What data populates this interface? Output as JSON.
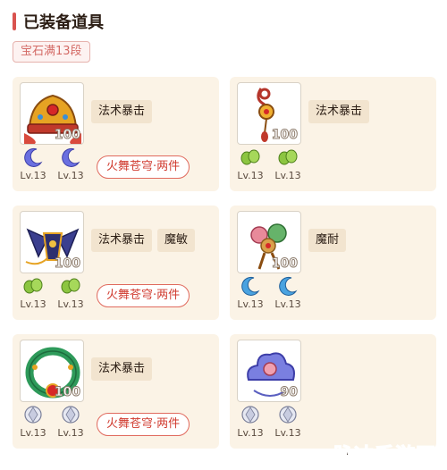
{
  "header": {
    "title": "已装备道具"
  },
  "tag": {
    "label": "宝石满13段"
  },
  "cards": [
    {
      "level": "100",
      "attrs": [
        "法术暴击"
      ],
      "gems": [
        {
          "icon": "moon-gem-icon",
          "level": "Lv.13"
        },
        {
          "icon": "moon-gem-icon",
          "level": "Lv.13"
        }
      ],
      "set": "火舞苍穹·两件"
    },
    {
      "level": "100",
      "attrs": [
        "法术暴击"
      ],
      "gems": [
        {
          "icon": "leaf-gem-icon",
          "level": "Lv.13"
        },
        {
          "icon": "leaf-gem-icon",
          "level": "Lv.13"
        }
      ],
      "set": ""
    },
    {
      "level": "100",
      "attrs": [
        "法术暴击",
        "魔敏"
      ],
      "gems": [
        {
          "icon": "leaf-gem-icon",
          "level": "Lv.13"
        },
        {
          "icon": "leaf-gem-icon",
          "level": "Lv.13"
        }
      ],
      "set": "火舞苍穹·两件"
    },
    {
      "level": "100",
      "attrs": [
        "魔耐"
      ],
      "gems": [
        {
          "icon": "moon-gem-icon",
          "level": "Lv.13"
        },
        {
          "icon": "moon-gem-icon",
          "level": "Lv.13"
        }
      ],
      "set": ""
    },
    {
      "level": "100",
      "attrs": [
        "法术暴击"
      ],
      "gems": [
        {
          "icon": "diamond-gem-icon",
          "level": "Lv.13"
        },
        {
          "icon": "diamond-gem-icon",
          "level": "Lv.13"
        }
      ],
      "set": "火舞苍穹·两件"
    },
    {
      "level": "90",
      "attrs": [],
      "gems": [
        {
          "icon": "diamond-gem-icon",
          "level": "Lv.13"
        },
        {
          "icon": "diamond-gem-icon",
          "level": "Lv.13"
        }
      ],
      "set": ""
    }
  ],
  "watermark": "脉冲手游网",
  "colors": {
    "accent": "#d9534f",
    "card_bg": "#fbf3e6",
    "set_red": "#d03b2f"
  }
}
